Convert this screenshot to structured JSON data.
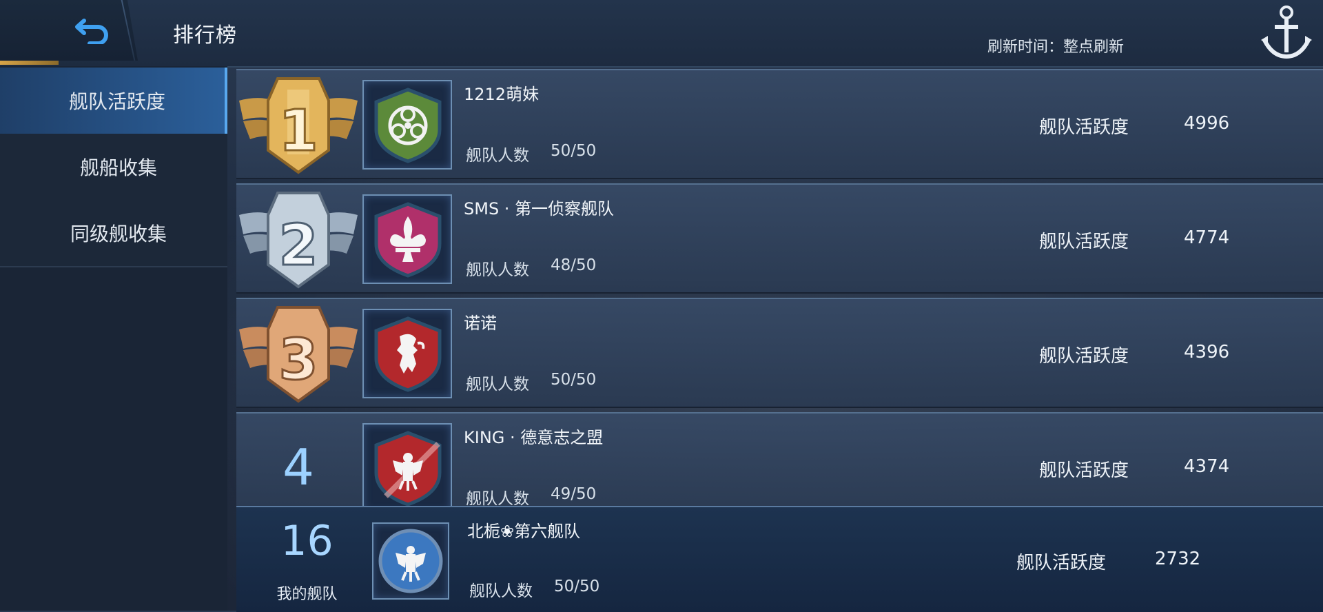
{
  "header": {
    "title": "排行榜",
    "refresh_text": "刷新时间：整点刷新",
    "back_icon": "back-arrow-icon",
    "corner_icon": "anchor-icon"
  },
  "sidebar": {
    "items": [
      {
        "label": "舰队活跃度",
        "active": true
      },
      {
        "label": "舰船收集",
        "active": false
      },
      {
        "label": "同级舰收集",
        "active": false
      }
    ]
  },
  "rankings": [
    {
      "rank": "1",
      "name": "1212萌妹",
      "members_label": "舰队人数",
      "members": "50/50",
      "activity_label": "舰队活跃度",
      "activity": "4996",
      "emblem": "biohazard-emblem-icon",
      "emblem_color": "#5c8a3a"
    },
    {
      "rank": "2",
      "name": "SMS · 第一侦察舰队",
      "members_label": "舰队人数",
      "members": "48/50",
      "activity_label": "舰队活跃度",
      "activity": "4774",
      "emblem": "fleur-de-lis-emblem-icon",
      "emblem_color": "#b0306a"
    },
    {
      "rank": "3",
      "name": "诺诺",
      "members_label": "舰队人数",
      "members": "50/50",
      "activity_label": "舰队活跃度",
      "activity": "4396",
      "emblem": "lion-emblem-icon",
      "emblem_color": "#b3282c"
    },
    {
      "rank": "4",
      "name": "KING · 德意志之盟",
      "members_label": "舰队人数",
      "members": "49/50",
      "activity_label": "舰队活跃度",
      "activity": "4374",
      "emblem": "eagle-emblem-icon",
      "emblem_color": "#b3282c"
    }
  ],
  "my_fleet": {
    "rank": "16",
    "rank_label": "我的舰队",
    "name": "北栀❀第六舰队",
    "members_label": "舰队人数",
    "members": "50/50",
    "activity_label": "舰队活跃度",
    "activity": "2732",
    "emblem": "eagle-emblem-icon",
    "emblem_color": "#3c78c0"
  },
  "colors": {
    "gold": "#d8a548",
    "silver": "#b9c6d3",
    "bronze": "#d99a6a",
    "accent": "#59a8ee"
  }
}
